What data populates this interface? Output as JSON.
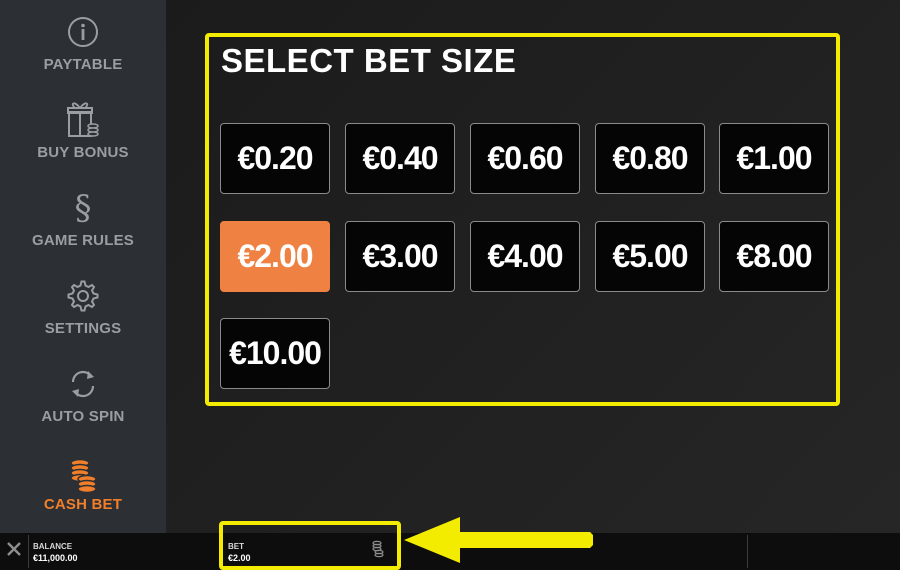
{
  "sidebar": {
    "items": [
      {
        "label": "PAYTABLE",
        "icon": "info-icon"
      },
      {
        "label": "BUY BONUS",
        "icon": "gift-icon"
      },
      {
        "label": "GAME RULES",
        "icon": "section-icon"
      },
      {
        "label": "SETTINGS",
        "icon": "gear-icon"
      },
      {
        "label": "AUTO SPIN",
        "icon": "refresh-icon"
      },
      {
        "label": "CASH BET",
        "icon": "coins-icon"
      }
    ],
    "active": "CASH BET"
  },
  "panel": {
    "title": "SELECT BET SIZE",
    "bets": [
      "€0.20",
      "€0.40",
      "€0.60",
      "€0.80",
      "€1.00",
      "€2.00",
      "€3.00",
      "€4.00",
      "€5.00",
      "€8.00",
      "€10.00"
    ],
    "selected": "€2.00"
  },
  "bottom": {
    "close_icon": "x",
    "balance_label": "BALANCE",
    "balance_value": "€11,000.00",
    "bet_label": "BET",
    "bet_value": "€2.00"
  },
  "colors": {
    "accent": "#ef8142",
    "highlight": "#f3ec00",
    "sidebar_bg": "#2c2f33"
  }
}
